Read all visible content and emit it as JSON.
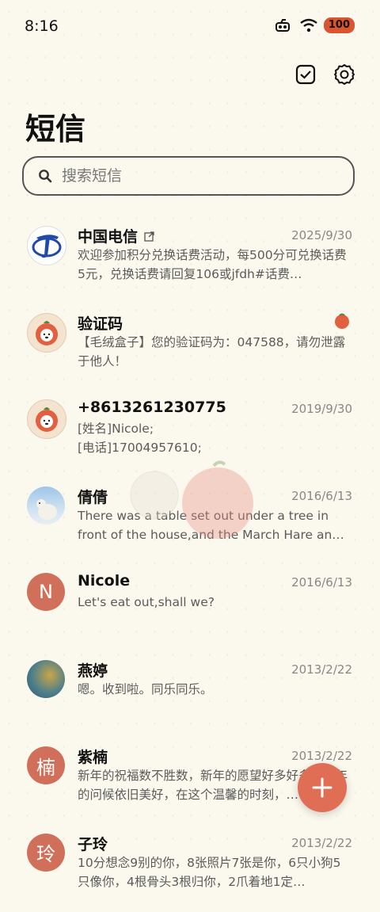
{
  "status_bar": {
    "time": "8:16",
    "battery": "100"
  },
  "header": {
    "title": "短信"
  },
  "search": {
    "placeholder": "搜索短信"
  },
  "conversations": [
    {
      "name": "中国电信",
      "date": "2025/9/30",
      "preview": "欢迎参加积分兑换话费活动，每500分可兑换话费5元，兑换话费请回复106或jfdh#话费…",
      "avatar": "china-telecom-logo"
    },
    {
      "name": "验证码",
      "date": "",
      "preview": "【毛绒盒子】您的验证码为：047588，请勿泄露于他人！",
      "avatar": "dog-tomato-avatar"
    },
    {
      "name": "+8613261230775",
      "date": "2019/9/30",
      "preview": "[姓名]Nicole;\n[电话]17004957610;",
      "avatar": "dog-tomato-avatar"
    },
    {
      "name": "倩倩",
      "date": "2016/6/13",
      "preview": "There was a table set out under a tree in front of the house,and the March Hare an…",
      "avatar": "polar-bear-photo"
    },
    {
      "name": "Nicole",
      "date": "2016/6/13",
      "preview": "Let's eat out,shall we?",
      "avatar_letter": "N"
    },
    {
      "name": "燕婷",
      "date": "2013/2/22",
      "preview": "嗯。收到啦。同乐同乐。",
      "avatar": "sea-photo"
    },
    {
      "name": "紫楠",
      "date": "2013/2/22",
      "preview": "新年的祝福数不胜数，新年的愿望好多好多，新年的问候依旧美好，在这个温馨的时刻，…",
      "avatar_letter": "楠"
    },
    {
      "name": "子玲",
      "date": "2013/2/22",
      "preview": "10分想念9别的你，8张照片7张是你，6只小狗5只像你，4根骨头3根归你，2爪着地1定…",
      "avatar_letter": "玲"
    }
  ],
  "colors": {
    "accent": "#e06e55",
    "background": "#fbf8ee",
    "avatar_letter_bg": "#d06f5a"
  }
}
